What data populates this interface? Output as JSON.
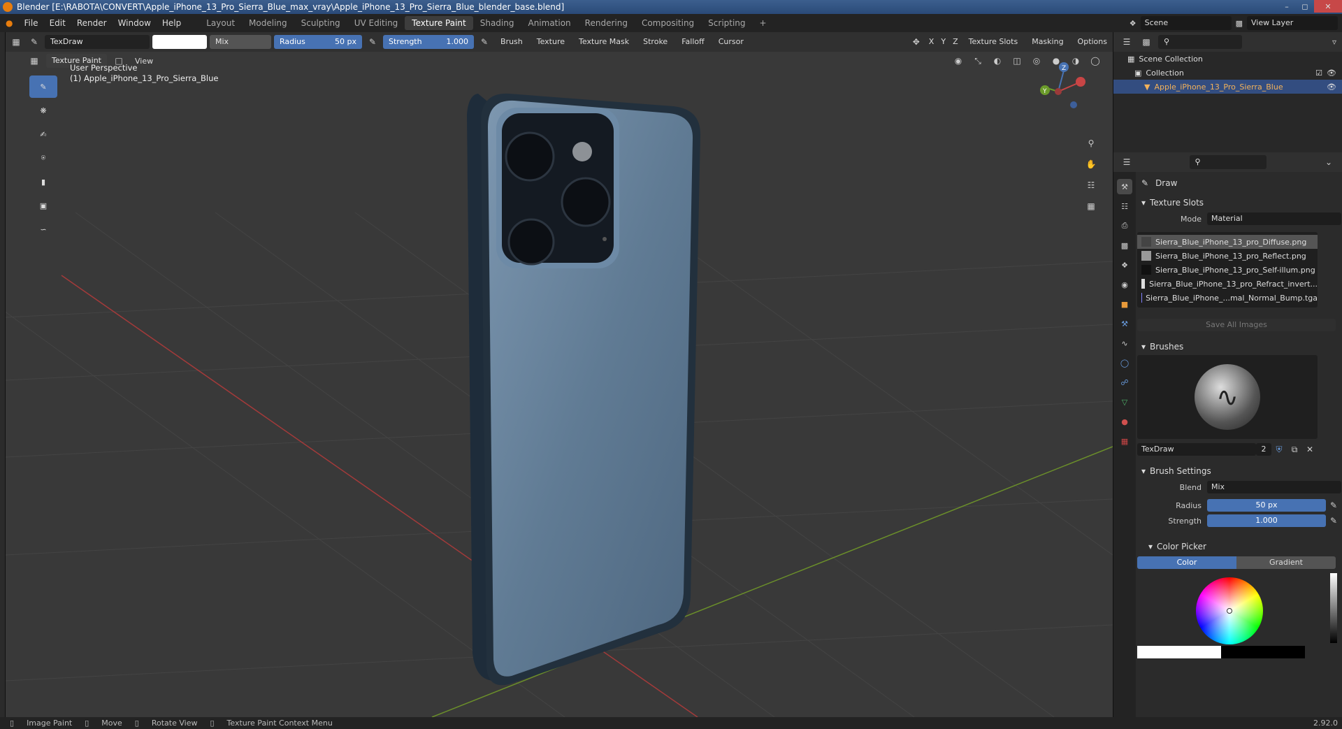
{
  "title": "Blender [E:\\RABOTA\\CONVERT\\Apple_iPhone_13_Pro_Sierra_Blue_max_vray\\Apple_iPhone_13_Pro_Sierra_Blue_blender_base.blend]",
  "menu": [
    "File",
    "Edit",
    "Render",
    "Window",
    "Help"
  ],
  "workspaces": [
    "Layout",
    "Modeling",
    "Sculpting",
    "UV Editing",
    "Texture Paint",
    "Shading",
    "Animation",
    "Rendering",
    "Compositing",
    "Scripting"
  ],
  "active_workspace": "Texture Paint",
  "scene": "Scene",
  "view_layer": "View Layer",
  "toolheader": {
    "brush_name": "TexDraw",
    "blend": "Mix",
    "radius_label": "Radius",
    "radius_value": "50 px",
    "strength_label": "Strength",
    "strength_value": "1.000",
    "dropdowns": [
      "Brush",
      "Texture",
      "Texture Mask",
      "Stroke",
      "Falloff",
      "Cursor"
    ],
    "axes": [
      "X",
      "Y",
      "Z"
    ],
    "right_dropdowns": [
      "Texture Slots",
      "Masking",
      "Options"
    ]
  },
  "viewport": {
    "mode": "Texture Paint",
    "view_menu": "View",
    "info_line1": "User Perspective",
    "info_line2": "(1) Apple_iPhone_13_Pro_Sierra_Blue",
    "accent_x_axis": "#a33a3a",
    "accent_y_axis": "#6b8f2a",
    "phone_color": "#5e7790"
  },
  "outliner": {
    "scene_collection": "Scene Collection",
    "collection": "Collection",
    "object": "Apple_iPhone_13_Pro_Sierra_Blue"
  },
  "properties": {
    "tool_name": "Draw",
    "texture_slots": {
      "title": "Texture Slots",
      "mode_label": "Mode",
      "mode_value": "Material",
      "slots": [
        "Sierra_Blue_iPhone_13_pro_Diffuse.png",
        "Sierra_Blue_iPhone_13_pro_Reflect.png",
        "Sierra_Blue_iPhone_13_pro_Self-illum.png",
        "Sierra_Blue_iPhone_13_pro_Refract_invert...",
        "Sierra_Blue_iPhone_...mal_Normal_Bump.tga"
      ],
      "save_all": "Save All Images"
    },
    "brushes": {
      "title": "Brushes",
      "name": "TexDraw",
      "users": "2"
    },
    "brush_settings": {
      "title": "Brush Settings",
      "blend_label": "Blend",
      "blend_value": "Mix",
      "radius_label": "Radius",
      "radius_value": "50 px",
      "strength_label": "Strength",
      "strength_value": "1.000"
    },
    "color_picker": {
      "title": "Color Picker",
      "tab_color": "Color",
      "tab_gradient": "Gradient"
    }
  },
  "statusbar": {
    "item1": "Image Paint",
    "item2": "Move",
    "item3": "Rotate View",
    "item4": "Texture Paint Context Menu",
    "version": "2.92.0"
  }
}
